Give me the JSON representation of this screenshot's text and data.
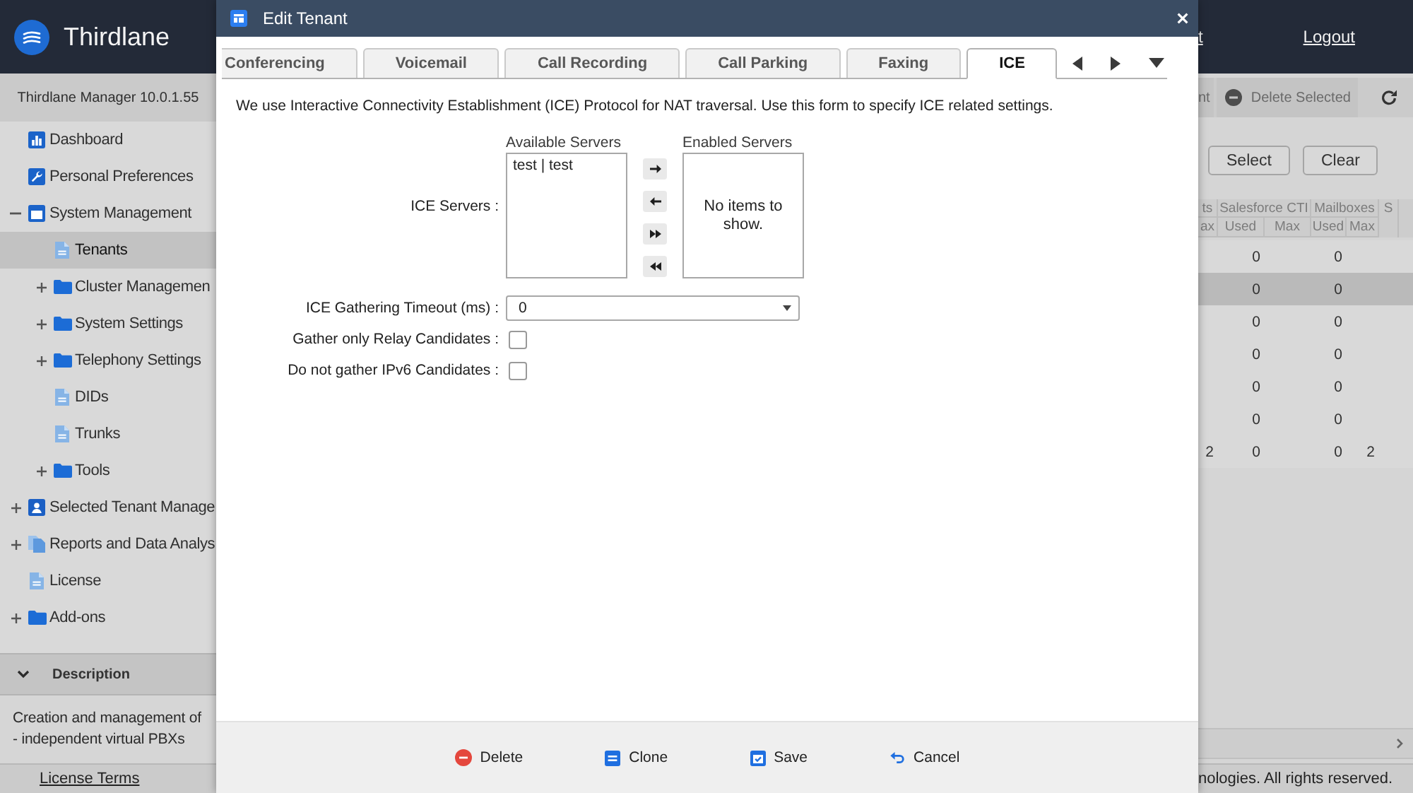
{
  "app_header": {
    "brand": "Thirdlane",
    "links": [
      {
        "label": "t"
      },
      {
        "label": "Logout"
      }
    ]
  },
  "sidebar": {
    "version": "Thirdlane Manager 10.0.1.55",
    "tree": [
      {
        "label": "Dashboard",
        "kind": "dashboard",
        "selected": false
      },
      {
        "label": "Personal Preferences",
        "kind": "preferences",
        "selected": false
      },
      {
        "label": "System Management",
        "kind": "system",
        "expanded": true,
        "selected": false,
        "children": [
          {
            "label": "Tenants",
            "kind": "page",
            "selected": true
          },
          {
            "label": "Cluster Managemen",
            "kind": "folder",
            "expanded": false,
            "selected": false
          },
          {
            "label": "System Settings",
            "kind": "folder",
            "expanded": false,
            "selected": false
          },
          {
            "label": "Telephony Settings",
            "kind": "folder",
            "expanded": false,
            "selected": false
          },
          {
            "label": "DIDs",
            "kind": "page",
            "selected": false
          },
          {
            "label": "Trunks",
            "kind": "page",
            "selected": false
          },
          {
            "label": "Tools",
            "kind": "folder",
            "expanded": false,
            "selected": false
          }
        ]
      },
      {
        "label": "Selected Tenant Manage",
        "kind": "tenant",
        "expanded": false,
        "selected": false
      },
      {
        "label": "Reports and Data Analys",
        "kind": "reports",
        "expanded": false,
        "selected": false
      },
      {
        "label": "License",
        "kind": "page",
        "selected": false
      },
      {
        "label": "Add-ons",
        "kind": "folder",
        "expanded": false,
        "selected": false
      }
    ],
    "description": {
      "title": "Description",
      "expanded": true,
      "lines": [
        "Creation and management of",
        "- independent virtual PBXs"
      ]
    },
    "footer_link": "License Terms"
  },
  "toolbar": {
    "buttons": [
      {
        "label": "nt",
        "kind": "plain",
        "disabled": true
      },
      {
        "label": "Delete Selected",
        "kind": "delete",
        "disabled": true
      }
    ]
  },
  "filter_buttons": [
    {
      "label": "Select"
    },
    {
      "label": "Clear"
    }
  ],
  "table": {
    "column_groups": [
      {
        "label": "ts",
        "columns": [
          "ax"
        ]
      },
      {
        "label": "Salesforce CTI",
        "columns": [
          "Used",
          "Max"
        ]
      },
      {
        "label": "Mailboxes",
        "columns": [
          "Used",
          "Max"
        ]
      },
      {
        "label": "S"
      }
    ],
    "rows": [
      {
        "selected": false,
        "salesforce_cti_used": "0",
        "mailboxes_used": "0"
      },
      {
        "selected": true,
        "salesforce_cti_used": "0",
        "mailboxes_used": "0"
      },
      {
        "selected": false,
        "salesforce_cti_used": "0",
        "mailboxes_used": "0"
      },
      {
        "selected": false,
        "salesforce_cti_used": "0",
        "mailboxes_used": "0"
      },
      {
        "selected": false,
        "salesforce_cti_used": "0",
        "mailboxes_used": "0"
      },
      {
        "selected": false,
        "salesforce_cti_used": "0",
        "mailboxes_used": "0"
      },
      {
        "selected": false,
        "column_1": "2",
        "salesforce_cti_used": "0",
        "mailboxes_used": "0",
        "mailboxes_max": "2"
      }
    ]
  },
  "footer": {
    "copyright": "nologies. All rights reserved."
  },
  "modal": {
    "title": "Edit Tenant",
    "tabs": [
      {
        "label": "Conferencing",
        "selected": false
      },
      {
        "label": "Voicemail",
        "selected": false
      },
      {
        "label": "Call Recording",
        "selected": false
      },
      {
        "label": "Call Parking",
        "selected": false
      },
      {
        "label": "Faxing",
        "selected": false
      },
      {
        "label": "ICE",
        "selected": true
      }
    ],
    "intro": "We use Interactive Connectivity Establishment (ICE) Protocol for NAT traversal. Use this form to specify ICE related settings.",
    "ice_servers": {
      "label": "ICE Servers :",
      "available": {
        "title": "Available Servers",
        "items": [
          {
            "label": "test | test",
            "selected": false
          }
        ]
      },
      "enabled": {
        "title": "Enabled Servers",
        "empty_text": "No items to show."
      }
    },
    "fields": [
      {
        "kind": "select",
        "label": "ICE Gathering Timeout (ms) :",
        "value": "0"
      },
      {
        "kind": "checkbox",
        "label": "Gather only Relay Candidates :",
        "checked": false
      },
      {
        "kind": "checkbox",
        "label": "Do not gather IPv6 Candidates :",
        "checked": false
      }
    ],
    "actions": [
      {
        "label": "Delete",
        "kind": "delete"
      },
      {
        "label": "Clone",
        "kind": "clone"
      },
      {
        "label": "Save",
        "kind": "save"
      },
      {
        "label": "Cancel",
        "kind": "cancel"
      }
    ]
  }
}
